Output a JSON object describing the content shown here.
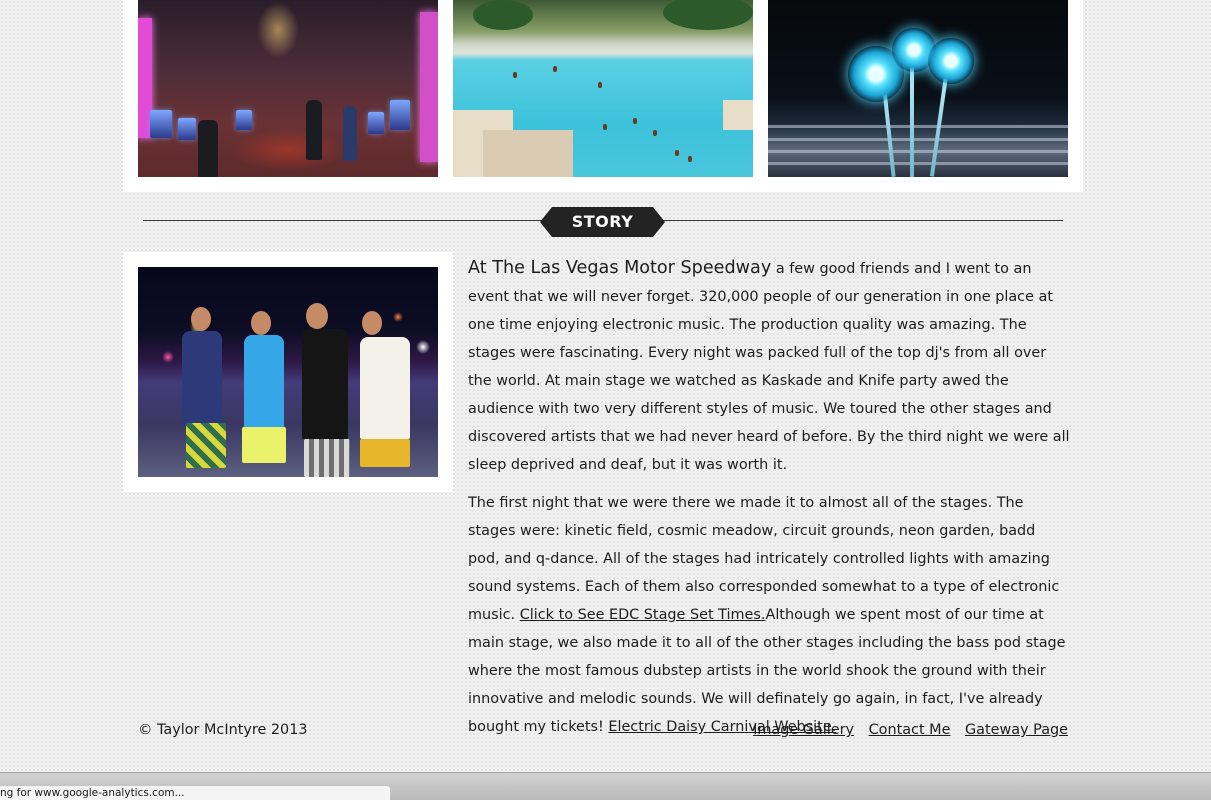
{
  "story": {
    "section_label": "STORY",
    "lead_in": "At The Las Vegas Motor Speedway",
    "paragraph1_rest": " a few good friends and I went to an event that we will never forget. 320,000 people of our generation in one place at one time enjoying electronic music. The production quality was amazing. The stages were fascinating. Every night was packed full of the top dj's from all over the world. At main stage we watched as Kaskade and Knife party awed the audience with two very different styles of music. We toured the other stages and discovered artists that we had never heard of before. By the third night we were all sleep deprived and deaf, but it was worth it.",
    "paragraph2_start": "The first night that we were there we made it to almost all of the stages. The stages were: kinetic field, cosmic meadow, circuit grounds, neon garden, badd pod, and q-dance. All of the stages had intricately controlled lights with amazing sound systems. Each of them also corresponded somewhat to a type of electronic music. ",
    "stage_times_link": "Click to See EDC Stage Set Times.",
    "paragraph2_middle": "Although we spent most of our time at main stage, we also made it to all of the other stages including the bass pod stage where the most famous dubstep artists in the world shook the ground with their innovative and melodic sounds. We will definately go again, in fact, I've already bought my tickets! ",
    "website_link": "Electric Daisy Carnival Website."
  },
  "footer": {
    "copyright": "© Taylor McIntyre 2013",
    "links": [
      "Image Gallery",
      "Contact Me",
      "Gateway Page"
    ]
  },
  "browser": {
    "status_text": "ng for www.google-analytics.com..."
  }
}
